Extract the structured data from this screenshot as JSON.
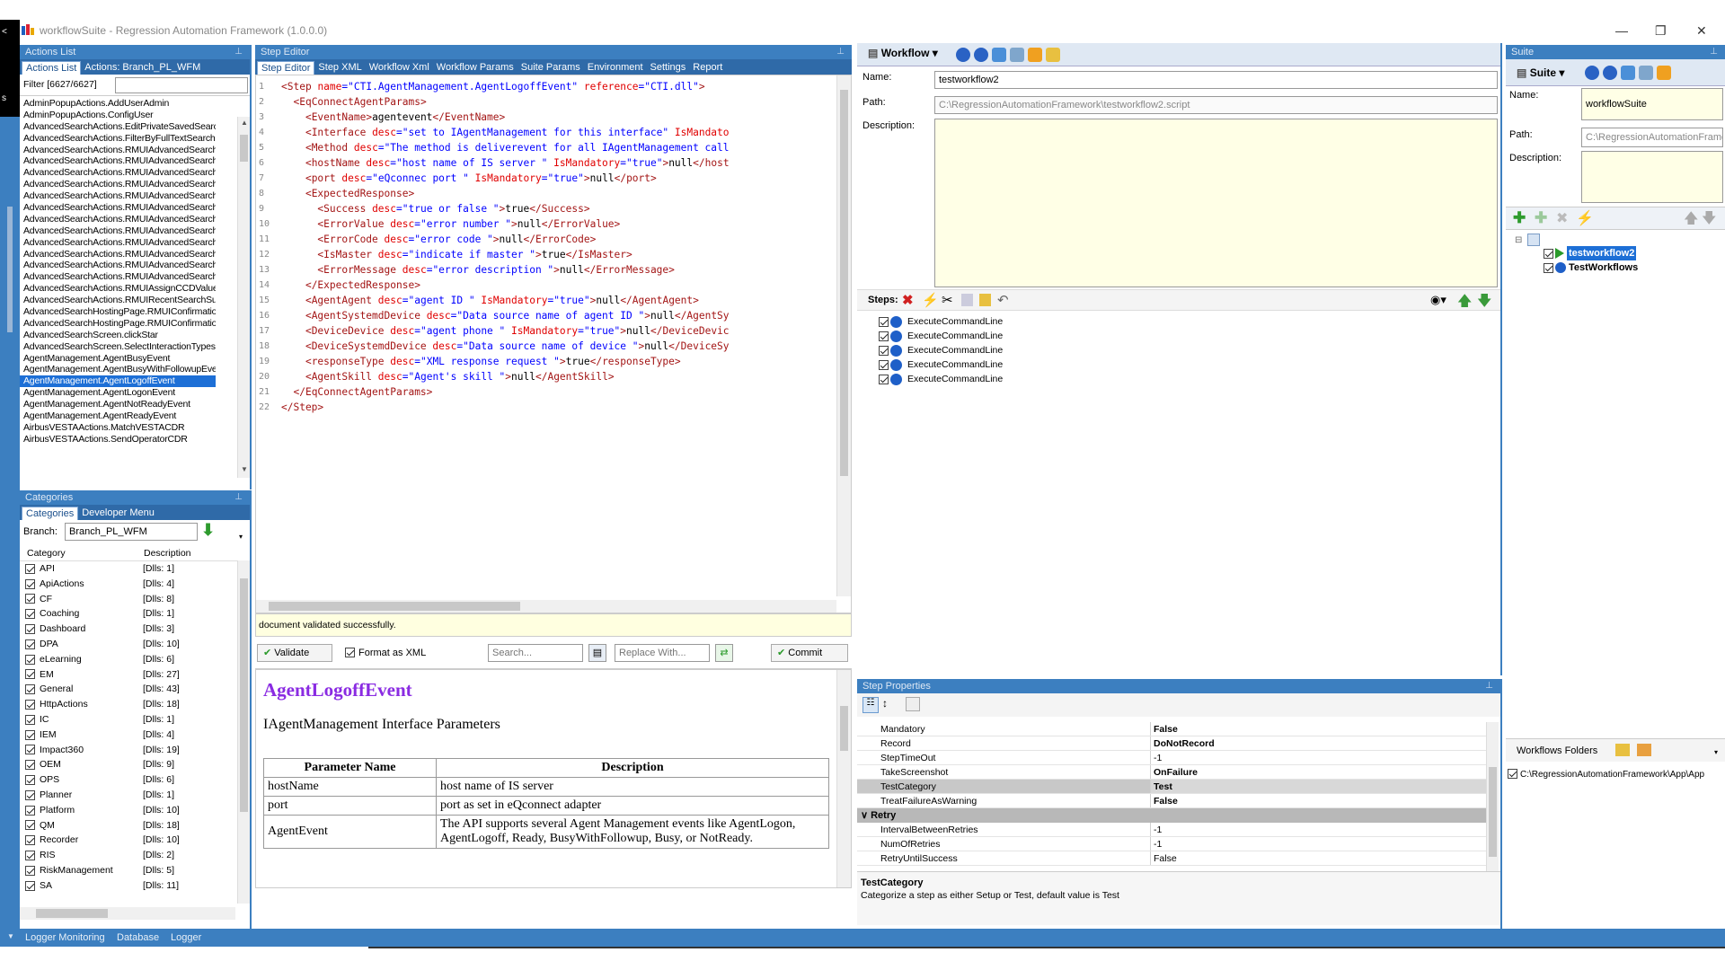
{
  "window": {
    "title": "workflowSuite - Regression Automation Framework (1.0.0.0)",
    "minimize": "—",
    "restore": "❐",
    "close": "✕"
  },
  "side": {
    "labels": [
      "<",
      "s"
    ]
  },
  "actions_panel": {
    "title": "Actions List",
    "tabs": [
      "Actions List",
      "Actions: Branch_PL_WFM"
    ],
    "filter_label": "Filter [6627/6627]",
    "items": [
      "AdminPopupActions.AddUserAdmin",
      "AdminPopupActions.ConfigUser",
      "AdvancedSearchActions.EditPrivateSavedSearch",
      "AdvancedSearchActions.FilterByFullTextSearch",
      "AdvancedSearchActions.RMUIAdvancedSearch",
      "AdvancedSearchActions.RMUIAdvancedSearchC",
      "AdvancedSearchActions.RMUIAdvancedSearchC",
      "AdvancedSearchActions.RMUIAdvancedSearchC",
      "AdvancedSearchActions.RMUIAdvancedSearchI",
      "AdvancedSearchActions.RMUIAdvancedSearchI",
      "AdvancedSearchActions.RMUIAdvancedSearchS",
      "AdvancedSearchActions.RMUIAdvancedSearchV",
      "AdvancedSearchActions.RMUIAdvancedSearchV",
      "AdvancedSearchActions.RMUIAdvancedSearchV",
      "AdvancedSearchActions.RMUIAdvancedSearchV",
      "AdvancedSearchActions.RMUIAdvancedSearchV",
      "AdvancedSearchActions.RMUIAssignCCDValueT",
      "AdvancedSearchActions.RMUIRecentSearchSur",
      "AdvancedSearchHostingPage.RMUIConfirmation",
      "AdvancedSearchHostingPage.RMUIConfirmation",
      "AdvancedSearchScreen.clickStar",
      "AdvancedSearchScreen.SelectInteractionTypes",
      "AgentManagement.AgentBusyEvent",
      "AgentManagement.AgentBusyWithFollowupEvent",
      "AgentManagement.AgentLogoffEvent",
      "AgentManagement.AgentLogonEvent",
      "AgentManagement.AgentNotReadyEvent",
      "AgentManagement.AgentReadyEvent",
      "AirbusVESTAActions.MatchVESTACDR",
      "AirbusVESTAActions.SendOperatorCDR"
    ],
    "selected_index": 24
  },
  "categories_panel": {
    "title": "Categories",
    "tabs": [
      "Categories",
      "Developer Menu"
    ],
    "branch_label": "Branch:",
    "branch_value": "Branch_PL_WFM",
    "col_category": "Category",
    "col_description": "Description",
    "rows": [
      [
        "API",
        "[Dlls: 1]"
      ],
      [
        "ApiActions",
        "[Dlls: 4]"
      ],
      [
        "CF",
        "[Dlls: 8]"
      ],
      [
        "Coaching",
        "[Dlls: 1]"
      ],
      [
        "Dashboard",
        "[Dlls: 3]"
      ],
      [
        "DPA",
        "[Dlls: 10]"
      ],
      [
        "eLearning",
        "[Dlls: 6]"
      ],
      [
        "EM",
        "[Dlls: 27]"
      ],
      [
        "General",
        "[Dlls: 43]"
      ],
      [
        "HttpActions",
        "[Dlls: 18]"
      ],
      [
        "IC",
        "[Dlls: 1]"
      ],
      [
        "IEM",
        "[Dlls: 4]"
      ],
      [
        "Impact360",
        "[Dlls: 19]"
      ],
      [
        "OEM",
        "[Dlls: 9]"
      ],
      [
        "OPS",
        "[Dlls: 6]"
      ],
      [
        "Planner",
        "[Dlls: 1]"
      ],
      [
        "Platform",
        "[Dlls: 10]"
      ],
      [
        "QM",
        "[Dlls: 18]"
      ],
      [
        "Recorder",
        "[Dlls: 10]"
      ],
      [
        "RIS",
        "[Dlls: 2]"
      ],
      [
        "RiskManagement",
        "[Dlls: 5]"
      ],
      [
        "SA",
        "[Dlls: 11]"
      ]
    ]
  },
  "step_editor": {
    "title": "Step Editor",
    "tabs": [
      "Step Editor",
      "Step XML",
      "Workflow Xml",
      "Workflow Params",
      "Suite Params",
      "Environment",
      "Settings",
      "Report"
    ],
    "line_numbers": [
      "1",
      "2",
      "3",
      "4",
      "5",
      "6",
      "7",
      "8",
      "9",
      "10",
      "11",
      "12",
      "13",
      "14",
      "15",
      "16",
      "17",
      "18",
      "19",
      "20",
      "21",
      "22"
    ],
    "status_message": "document validated successfully.",
    "validate_label": "Validate",
    "format_label": "Format as XML",
    "search_placeholder": "Search...",
    "replace_placeholder": "Replace With...",
    "commit_label": "Commit",
    "doc_title": "AgentLogoffEvent",
    "doc_subtitle": "IAgentManagement Interface Parameters",
    "doc_headers": [
      "Parameter Name",
      "Description"
    ],
    "doc_rows": [
      [
        "hostName",
        "host name of IS server"
      ],
      [
        "port",
        "port as set in eQconnect adapter"
      ],
      [
        "AgentEvent",
        "The API supports several Agent Management events like AgentLogon, AgentLogoff, Ready, BusyWithFollowup, Busy, or NotReady."
      ]
    ]
  },
  "code_lines": [
    "<Step name=\"CTI.AgentManagement.AgentLogoffEvent\" reference=\"CTI.dll\">",
    "  <EqConnectAgentParams>",
    "    <EventName>agentevent</EventName>",
    "    <Interface desc=\"set to IAgentManagement for this interface\" IsMandato",
    "    <Method desc=\"The method is deliverevent for all IAgentManagement call",
    "    <hostName desc=\"host name of IS server \" IsMandatory=\"true\">null</host",
    "    <port desc=\"eQconnec port \" IsMandatory=\"true\">null</port>",
    "    <ExpectedResponse>",
    "      <Success desc=\"true or false \">true</Success>",
    "      <ErrorValue desc=\"error number \">null</ErrorValue>",
    "      <ErrorCode desc=\"error code \">null</ErrorCode>",
    "      <IsMaster desc=\"indicate if master \">true</IsMaster>",
    "      <ErrorMessage desc=\"error description \">null</ErrorMessage>",
    "    </ExpectedResponse>",
    "    <AgentAgent desc=\"agent ID \" IsMandatory=\"true\">null</AgentAgent>",
    "    <AgentSystemdDevice desc=\"Data source name of agent ID \">null</AgentSy",
    "    <DeviceDevice desc=\"agent phone \" IsMandatory=\"true\">null</DeviceDevic",
    "    <DeviceSystemdDevice desc=\"Data source name of device \">null</DeviceSy",
    "    <responseType desc=\"XML response request \">true</responseType>",
    "    <AgentSkill desc=\"Agent's skill \">null</AgentSkill>",
    "  </EqConnectAgentParams>",
    "</Step>"
  ],
  "workflow": {
    "menu_label": "Workflow",
    "name_label": "Name:",
    "name_value": "testworkflow2",
    "path_label": "Path:",
    "path_value": "C:\\RegressionAutomationFramework\\testworkflow2.script",
    "description_label": "Description:",
    "steps_label": "Steps:",
    "steps": [
      "ExecuteCommandLine",
      "ExecuteCommandLine",
      "ExecuteCommandLine",
      "ExecuteCommandLine",
      "ExecuteCommandLine"
    ]
  },
  "step_properties": {
    "title": "Step Properties",
    "rows": [
      [
        "Mandatory",
        "False",
        true
      ],
      [
        "Record",
        "DoNotRecord",
        true
      ],
      [
        "StepTimeOut",
        "-1",
        false
      ],
      [
        "TakeScreenshot",
        "OnFailure",
        true
      ],
      [
        "TestCategory",
        "Test",
        true
      ],
      [
        "TreatFailureAsWarning",
        "False",
        true
      ]
    ],
    "retry_group": "Retry",
    "retry_rows": [
      [
        "IntervalBetweenRetries",
        "-1"
      ],
      [
        "NumOfRetries",
        "-1"
      ],
      [
        "RetryUntilSuccess",
        "False"
      ]
    ],
    "help_title": "TestCategory",
    "help_text": "Categorize a step as either Setup or Test, default value is Test"
  },
  "suite": {
    "title": "Suite",
    "menu_label": "Suite",
    "name_label": "Name:",
    "name_value": "workflowSuite",
    "path_label": "Path:",
    "path_value": "C:\\RegressionAutomationFrame",
    "description_label": "Description:",
    "tree": [
      "testworkflow2",
      "TestWorkflows"
    ],
    "folders_label": "Workflows Folders",
    "folder_path": "C:\\RegressionAutomationFramework\\App\\App"
  },
  "statusbar": {
    "items": [
      "Logger Monitoring",
      "Database",
      "Logger"
    ]
  },
  "colors": {
    "panel_blue": "#3c7fc0",
    "selection": "#1d6fd6",
    "tag": "#a31515",
    "attr": "#e00000",
    "value": "#0000ff"
  }
}
